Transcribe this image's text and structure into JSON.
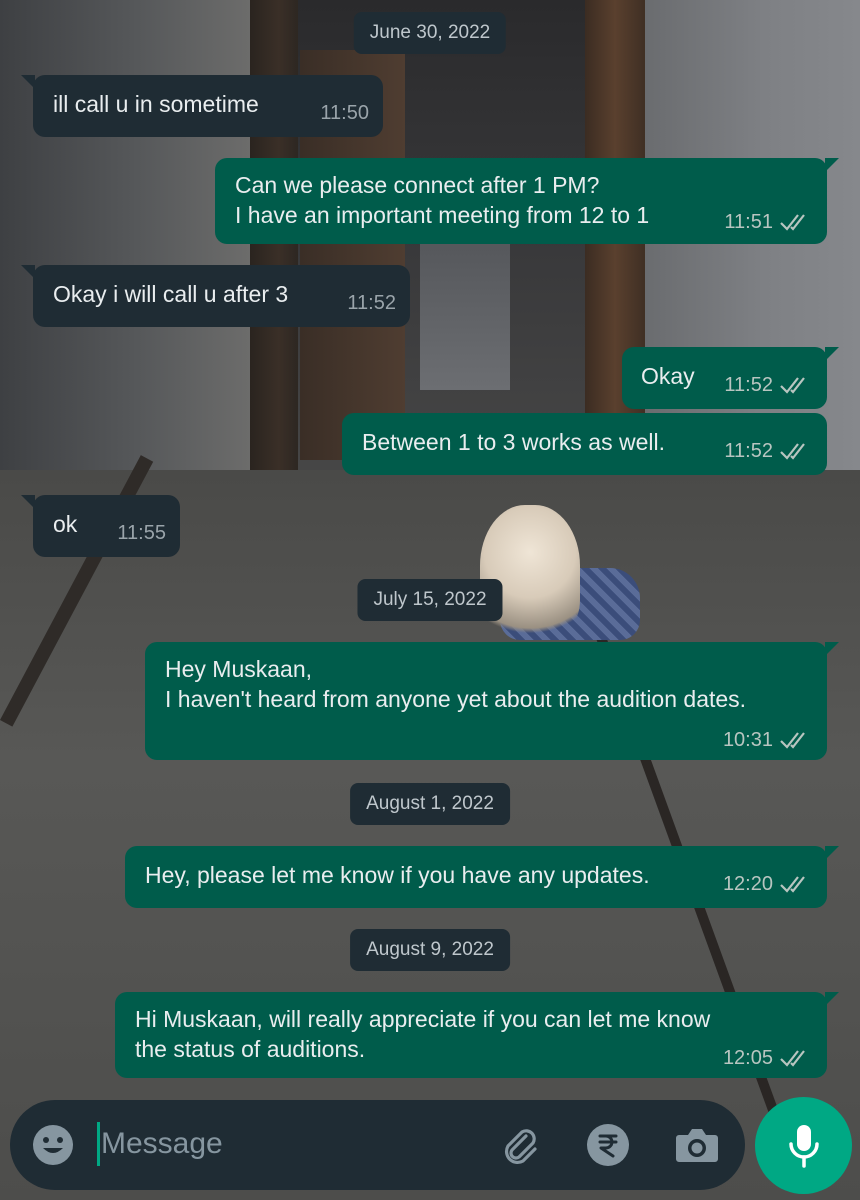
{
  "colors": {
    "incoming_bubble": "#1f2c34",
    "outgoing_bubble": "#005c4b",
    "accent": "#00a884",
    "text": "#e9edef",
    "meta_text": "#b8c5c0"
  },
  "chat": {
    "dates": {
      "d1": "June 30, 2022",
      "d2": "July 15, 2022",
      "d3": "August 1, 2022",
      "d4": "August 9, 2022"
    },
    "messages": [
      {
        "direction": "incoming",
        "lines": [
          "ill call u in sometime"
        ],
        "time": "11:50",
        "read_ticks": false
      },
      {
        "direction": "outgoing",
        "lines": [
          "Can we please connect after 1 PM?",
          "I have an important meeting from 12 to 1"
        ],
        "time": "11:51",
        "read_ticks": true
      },
      {
        "direction": "incoming",
        "lines": [
          "Okay i will call u after 3"
        ],
        "time": "11:52",
        "read_ticks": false
      },
      {
        "direction": "outgoing",
        "lines": [
          "Okay"
        ],
        "time": "11:52",
        "read_ticks": true
      },
      {
        "direction": "outgoing",
        "lines": [
          "Between 1 to 3 works as well."
        ],
        "time": "11:52",
        "read_ticks": true
      },
      {
        "direction": "incoming",
        "lines": [
          "ok"
        ],
        "time": "11:55",
        "read_ticks": false
      },
      {
        "direction": "outgoing",
        "lines": [
          "Hey Muskaan,",
          "I haven't heard from anyone yet about the audition dates."
        ],
        "time": "10:31",
        "read_ticks": true
      },
      {
        "direction": "outgoing",
        "lines": [
          "Hey, please let me know if you have any updates."
        ],
        "time": "12:20",
        "read_ticks": true
      },
      {
        "direction": "outgoing",
        "lines": [
          "Hi Muskaan, will really appreciate if you can let me know",
          "the status of auditions."
        ],
        "time": "12:05",
        "read_ticks": true
      }
    ]
  },
  "input_bar": {
    "placeholder": "Message",
    "icons": [
      "emoji-icon",
      "attach-icon",
      "rupee-payment-icon",
      "camera-icon"
    ],
    "send_icon": "mic-icon"
  }
}
